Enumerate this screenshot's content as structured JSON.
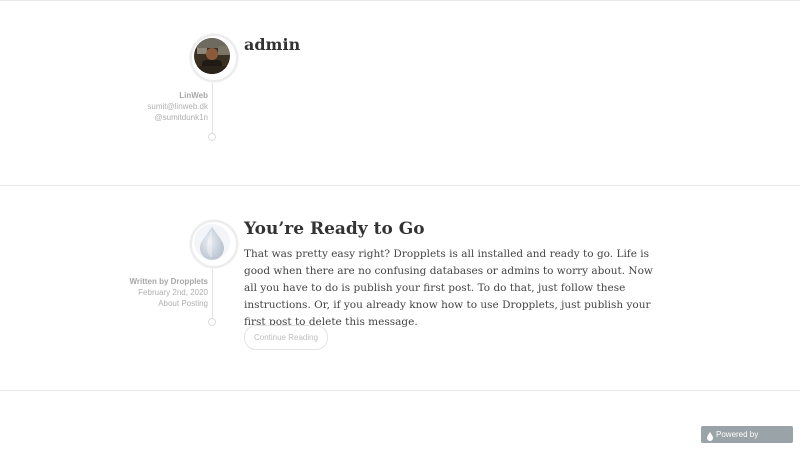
{
  "profile": {
    "name": "admin",
    "site": "LinWeb",
    "email": "sumit@linweb.dk",
    "handle": "@sumitdunk1n"
  },
  "post": {
    "title": "You’re Ready to Go",
    "byline": "Written by Dropplets",
    "date": "February 2nd, 2020",
    "category": "About Posting",
    "body": "That was pretty easy right? Dropplets is all installed and ready to go. Life is good when there are no confusing databases or admins to worry about. Now all you have to do is publish your first post. To do that, just follow these instructions. Or, if you already know how to use Dropplets, just publish your first post to delete this message.",
    "continue_label": "Continue Reading"
  },
  "footer": {
    "powered_label": "Powered by Dropplets"
  }
}
